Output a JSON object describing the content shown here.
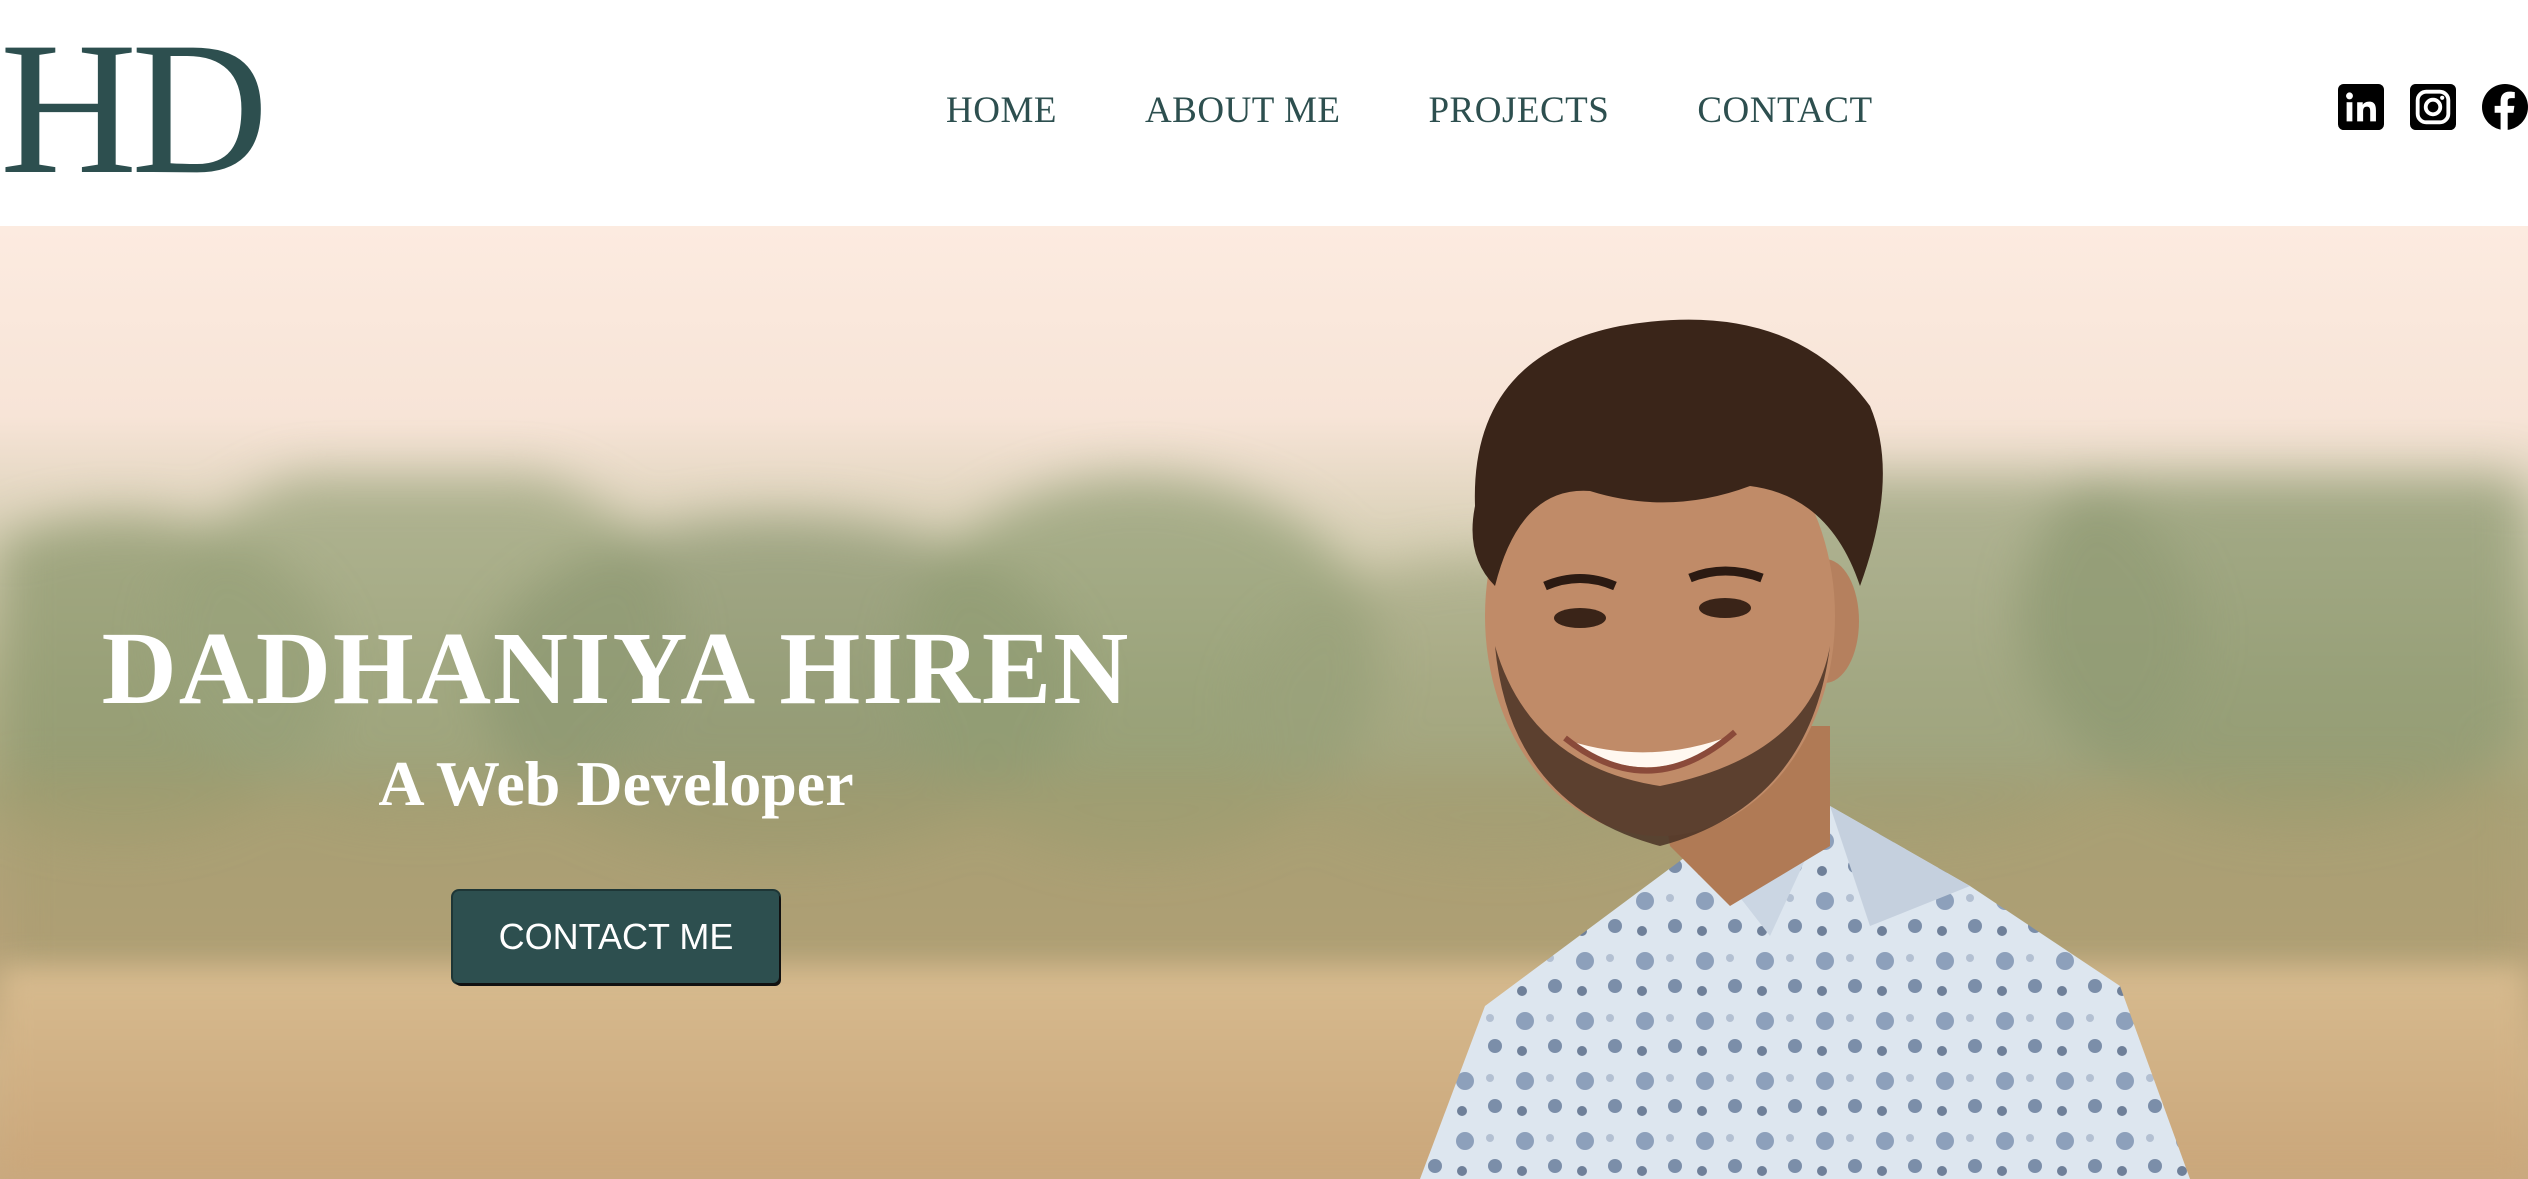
{
  "header": {
    "logo": "HD",
    "nav": [
      "HOME",
      "ABOUT ME",
      "PROJECTS",
      "CONTACT"
    ],
    "social_icons": [
      "linkedin-icon",
      "instagram-icon",
      "facebook-icon"
    ]
  },
  "hero": {
    "name": "DADHANIYA HIREN",
    "role": "A Web Developer",
    "cta_label": "CONTACT ME"
  },
  "colors": {
    "brand": "#2d4f4f",
    "white": "#ffffff",
    "icon": "#000000"
  }
}
